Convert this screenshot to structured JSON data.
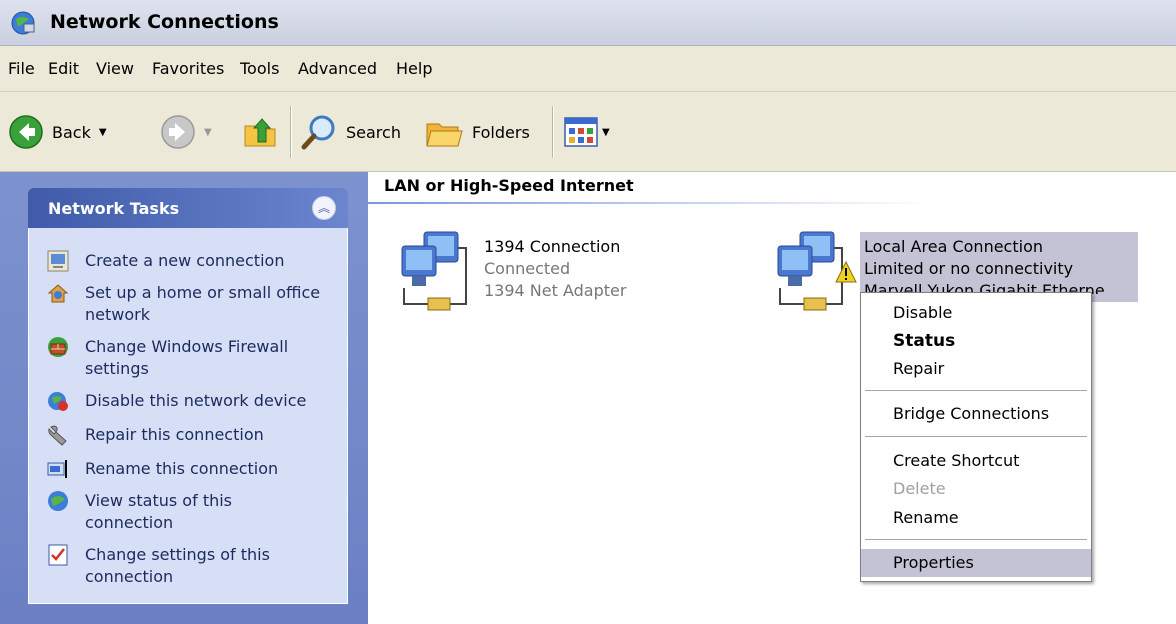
{
  "window": {
    "title": "Network Connections"
  },
  "menubar": [
    "File",
    "Edit",
    "View",
    "Favorites",
    "Tools",
    "Advanced",
    "Help"
  ],
  "toolbar": {
    "back": "Back",
    "search": "Search",
    "folders": "Folders"
  },
  "tasks": {
    "title": "Network Tasks",
    "items": [
      "Create a new connection",
      "Set up a home or small office network",
      "Change Windows Firewall settings",
      "Disable this network device",
      "Repair this connection",
      "Rename this connection",
      "View status of this connection",
      "Change settings of this connection"
    ]
  },
  "group": {
    "title": "LAN or High-Speed Internet"
  },
  "connections": [
    {
      "name": "1394 Connection",
      "status": "Connected",
      "device": "1394 Net Adapter"
    },
    {
      "name": "Local Area Connection",
      "status": "Limited or no connectivity",
      "device": "Marvell Yukon Gigabit Etherne..."
    }
  ],
  "context_menu": {
    "items": [
      "Disable",
      "Status",
      "Repair",
      "Bridge Connections",
      "Create Shortcut",
      "Delete",
      "Rename",
      "Properties"
    ],
    "default_item": "Status",
    "disabled_item": "Delete",
    "highlighted_item": "Properties"
  },
  "colors": {
    "menu_highlight": "#c4c3d6",
    "task_pane": "#6b80c3",
    "task_text": "#1d2a5e"
  }
}
